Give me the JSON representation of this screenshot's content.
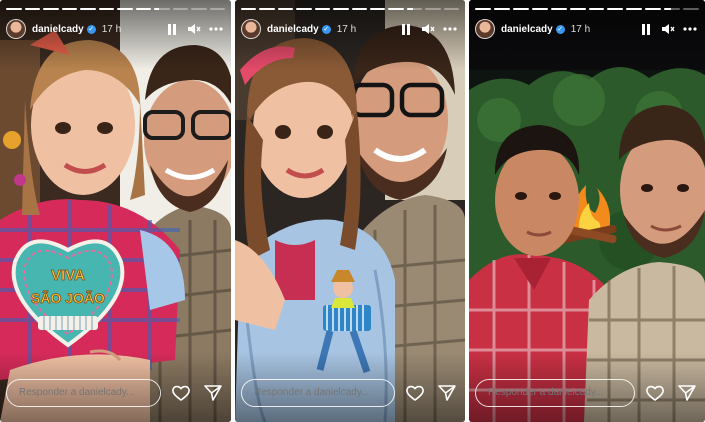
{
  "stories": [
    {
      "username": "danielcady",
      "time": "17 h",
      "reply_placeholder": "Responder a danielcady...",
      "progress": [
        1,
        1,
        1,
        1,
        1,
        1,
        1,
        1,
        0.35,
        0,
        0,
        0
      ]
    },
    {
      "username": "danielcady",
      "time": "17 h",
      "reply_placeholder": "Responder a danielcady...",
      "progress": [
        1,
        1,
        1,
        1,
        1,
        1,
        1,
        1,
        1,
        0.4,
        0,
        0
      ]
    },
    {
      "username": "danielcady",
      "time": "17 h",
      "reply_placeholder": "Responder a danielcady...",
      "progress": [
        1,
        1,
        1,
        1,
        1,
        1,
        1,
        1,
        1,
        1,
        0.4,
        0
      ]
    }
  ],
  "stickers": {
    "heart_line1": "VIVA",
    "heart_line2": "SÃO JOÃO"
  },
  "icons": [
    "pause-icon",
    "mute-icon",
    "more-icon",
    "heart-icon",
    "send-icon",
    "verified-icon"
  ]
}
